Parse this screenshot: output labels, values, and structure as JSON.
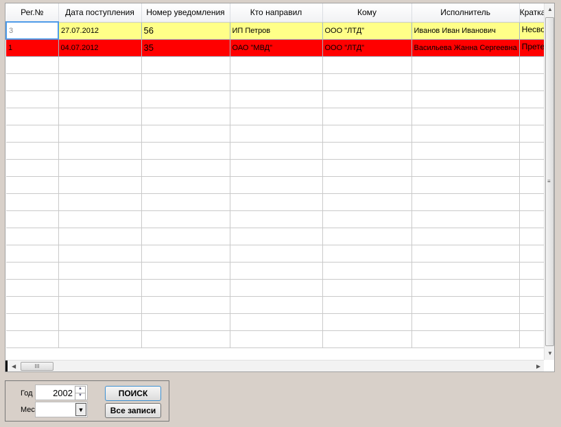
{
  "columns": [
    "Рег.№",
    "Дата поступления",
    "Номер уведомления",
    "Кто направил",
    "Кому",
    "Исполнитель",
    "Краткая"
  ],
  "rows": [
    {
      "reg": "3",
      "date": "27.07.2012",
      "num": "56",
      "from": "ИП Петров",
      "to": "ООО \"ЛТД\"",
      "exec": "Иванов Иван Иванович",
      "short": "Несвое"
    },
    {
      "reg": "1",
      "date": "04.07.2012",
      "num": "35",
      "from": "ОАО \"МВД\"",
      "to": "ООО \"ЛТД\"",
      "exec": "Васильева Жанна Сергеевна",
      "short": "Претен"
    }
  ],
  "colors": {
    "row_yellow": "#ffff88",
    "row_red": "#ff0000"
  },
  "filter": {
    "year_label": "Год",
    "year_value": "2002",
    "month_label": "Мес",
    "month_value": ""
  },
  "buttons": {
    "search": "ПОИСК",
    "all": "Все записи"
  },
  "scroll_thumb": "III"
}
